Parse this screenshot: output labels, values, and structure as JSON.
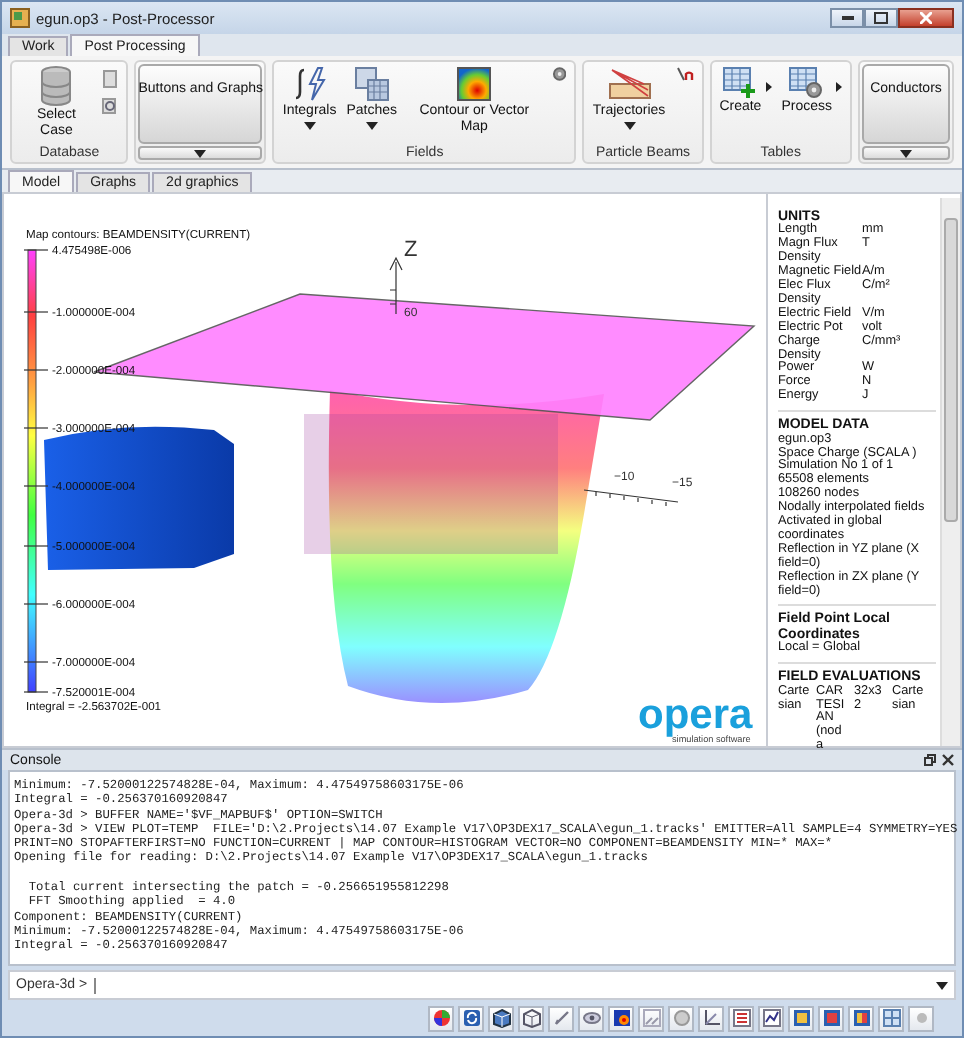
{
  "window": {
    "title": "egun.op3 - Post-Processor"
  },
  "ribbon_tabs": [
    {
      "label": "Work",
      "selected": false
    },
    {
      "label": "Post Processing",
      "selected": true
    }
  ],
  "ribbon_groups": [
    {
      "kind": "group",
      "label": "Database",
      "buttons": [
        {
          "kind": "large",
          "label": "Select Case"
        },
        {
          "kind": "icon_pair"
        }
      ]
    },
    {
      "kind": "big_dropdown",
      "label": "Buttons and Graphs"
    },
    {
      "kind": "group",
      "label": "Fields",
      "buttons": [
        {
          "kind": "menu",
          "label": "Integrals"
        },
        {
          "kind": "menu",
          "label": "Patches"
        },
        {
          "kind": "large",
          "label": "Contour or Vector Map"
        },
        {
          "kind": "icon"
        }
      ]
    },
    {
      "kind": "group",
      "label": "Particle Beams",
      "buttons": [
        {
          "kind": "menu",
          "label": "Trajectories"
        },
        {
          "kind": "icon"
        }
      ]
    },
    {
      "kind": "group",
      "label": "Tables",
      "buttons": [
        {
          "kind": "split",
          "label": "Create"
        },
        {
          "kind": "split",
          "label": "Process"
        }
      ]
    },
    {
      "kind": "big_dropdown",
      "label": "Conductors"
    }
  ],
  "view_tabs": [
    {
      "label": "Model",
      "selected": true
    },
    {
      "label": "Graphs",
      "selected": false
    },
    {
      "label": "2d graphics",
      "selected": false
    }
  ],
  "viewport": {
    "legend": {
      "title": "Map contours: BEAMDENSITY(CURRENT)",
      "ticks": [
        "4.475498E-006",
        "-1.000000E-004",
        "-2.000000E-004",
        "-3.000000E-004",
        "-4.000000E-004",
        "-5.000000E-004",
        "-6.000000E-004",
        "-7.000000E-004",
        "-7.520001E-004"
      ],
      "integral": "Integral = -2.563702E-001"
    },
    "axis_labels": [
      "Z",
      "60",
      "−10",
      "−15"
    ],
    "logo": {
      "name": "opera",
      "tagline": "simulation software"
    }
  },
  "info_panel": {
    "sections": [
      {
        "kind": "units",
        "title": "UNITS",
        "rows": [
          {
            "name": "Length",
            "unit": "mm"
          },
          {
            "name": "Magn Flux Density",
            "unit": "T"
          },
          {
            "name": "Magnetic Field",
            "unit": "A/m"
          },
          {
            "name": "Elec Flux Density",
            "unit": "C/m²"
          },
          {
            "name": "Electric Field",
            "unit": "V/m"
          },
          {
            "name": "Electric Pot",
            "unit": "volt"
          },
          {
            "name": "Charge Density",
            "unit": "C/mm³"
          },
          {
            "name": "Power",
            "unit": "W"
          },
          {
            "name": "Force",
            "unit": "N"
          },
          {
            "name": "Energy",
            "unit": "J"
          }
        ]
      },
      {
        "kind": "lines",
        "title": "MODEL DATA",
        "lines": [
          "egun.op3",
          "Space Charge (SCALA )",
          "Simulation No 1 of 1",
          "65508 elements",
          "108260 nodes",
          "Nodally interpolated fields",
          "Activated in global coordinates",
          "Reflection in YZ plane (X field=0)",
          "Reflection in ZX plane (Y field=0)"
        ]
      },
      {
        "kind": "lines",
        "title": "Field Point Local Coordinates",
        "lines": [
          "Local = Global"
        ]
      },
      {
        "kind": "table",
        "title": "FIELD EVALUATIONS",
        "cells": [
          "Cartesian",
          "CARTESIAN (noda",
          "32x32",
          "Cartesian"
        ]
      }
    ]
  },
  "console": {
    "title": "Console",
    "output": "Minimum: -7.52000122574828E-04, Maximum: 4.47549758603175E-06\nIntegral = -0.256370160920847\nOpera-3d > BUFFER NAME='$VF_MAPBUF$' OPTION=SWITCH\nOpera-3d > VIEW PLOT=TEMP  FILE='D:\\2.Projects\\14.07 Example V17\\OP3DEX17_SCALA\\egun_1.tracks' EMITTER=All SAMPLE=4 SYMMETRY=YES\nPRINT=NO STOPAFTERFIRST=NO FUNCTION=CURRENT | MAP CONTOUR=HISTOGRAM VECTOR=NO COMPONENT=BEAMDENSITY MIN=* MAX=*\nOpening file for reading: D:\\2.Projects\\14.07 Example V17\\OP3DEX17_SCALA\\egun_1.tracks\n\n  Total current intersecting the patch = -0.256651955812298\n  FFT Smoothing applied  = 4.0\nComponent: BEAMDENSITY(CURRENT)\nMinimum: -7.52000122574828E-04, Maximum: 4.47549758603175E-06\nIntegral = -0.256370160920847",
    "prompt": "Opera-3d >"
  }
}
